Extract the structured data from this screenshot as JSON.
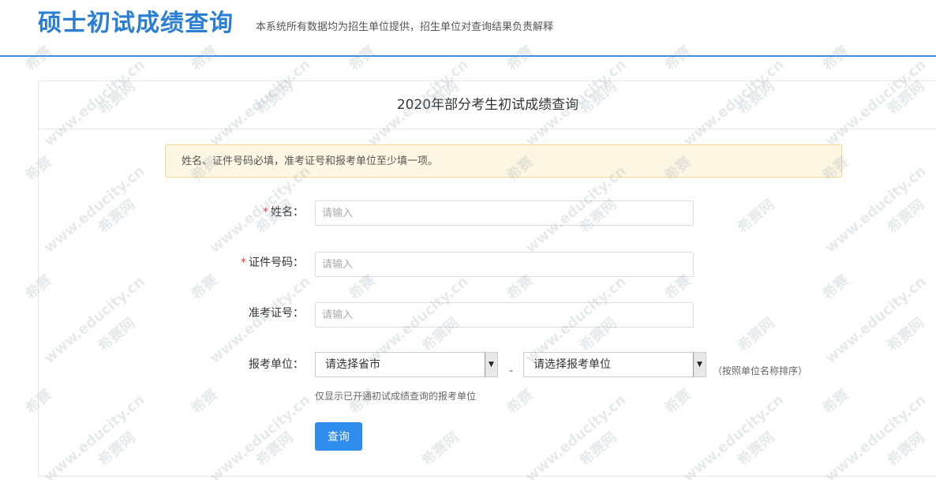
{
  "header": {
    "title": "硕士初试成绩查询",
    "subtitle": "本系统所有数据均为招生单位提供，招生单位对查询结果负责解释"
  },
  "panel": {
    "title": "2020年部分考生初试成绩查询",
    "notice": "姓名、证件号码必填，准考证号和报考单位至少填一项。"
  },
  "form": {
    "required_mark": "*",
    "name_label": "姓名：",
    "name_placeholder": "请输入",
    "id_label": "证件号码：",
    "id_placeholder": "请输入",
    "exam_no_label": "准考证号：",
    "exam_no_placeholder": "请输入",
    "unit_label": "报考单位：",
    "province_select": "请选择省市",
    "separator": "-",
    "unit_select": "请选择报考单位",
    "sort_hint": "（按照单位名称排序）",
    "help_text": "仅显示已开通初试成绩查询的报考单位",
    "query_button": "查询"
  },
  "watermark": {
    "brand": "希赛",
    "site": "www.educity.cn",
    "net": "希赛网"
  },
  "colors": {
    "accent": "#2e8ded",
    "title": "#2a7fd4",
    "required": "#e4393c",
    "notice_bg": "#fdf6e3",
    "notice_border": "#f5d98f"
  }
}
